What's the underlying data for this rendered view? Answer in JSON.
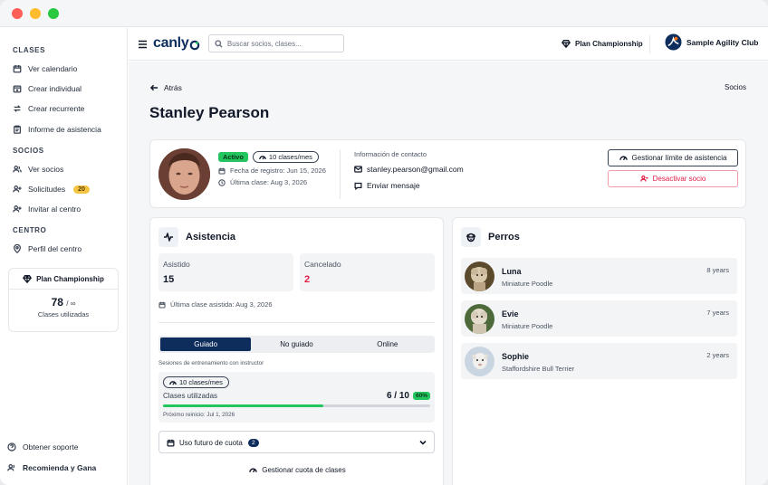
{
  "sidebar": {
    "sections": {
      "clases": "CLASES",
      "socios": "SOCIOS",
      "centro": "CENTRO"
    },
    "items": {
      "calendar": "Ver calendario",
      "individual": "Crear individual",
      "recurrent": "Crear recurrente",
      "attendance_report": "Informe de asistencia",
      "members": "Ver socios",
      "requests": "Solicitudes",
      "requests_badge": "20",
      "invite": "Invitar al centro",
      "profile": "Perfil del centro"
    },
    "plan": {
      "name": "Plan Championship",
      "count": "78",
      "limit": "/ ∞",
      "label": "Clases utilizadas"
    },
    "bottom": {
      "support": "Obtener soporte",
      "refer": "Recomienda y Gana"
    }
  },
  "topbar": {
    "logo": "canly",
    "search_placeholder": "Buscar socios, clases...",
    "plan": "Plan Championship",
    "club": "Sample Agility Club"
  },
  "page": {
    "back": "Atrás",
    "breadcrumb_right": "Socios",
    "title": "Stanley Pearson"
  },
  "profile": {
    "status": "Activo",
    "quota": "10 clases/mes",
    "registered": "Fecha de registro: Jun 15, 2026",
    "last_class": "Última clase: Aug 3, 2026",
    "contact_title": "Información de contacto",
    "email": "stanley.pearson@gmail.com",
    "message": "Enviar mensaje",
    "manage_limit": "Gestionar límite de asistencia",
    "deactivate": "Desactivar socio"
  },
  "attendance": {
    "title": "Asistencia",
    "attended_label": "Asistido",
    "attended_value": "15",
    "cancelled_label": "Cancelado",
    "cancelled_value": "2",
    "last_attended": "Última clase asistida: Aug 3, 2026",
    "tabs": [
      "Guiado",
      "No guiado",
      "Online"
    ],
    "tab_desc": "Sesiones de entrenamiento con instructor",
    "quota": "10 clases/mes",
    "used_label": "Clases utilizadas",
    "used_value": "6 / 10",
    "used_pct": "60%",
    "progress": 0.6,
    "reset": "Próximo reinicio: Jul 1, 2026",
    "future_label": "Uso futuro de cuota",
    "future_count": "2",
    "manage_quota": "Gestionar cuota de clases"
  },
  "dogs": {
    "title": "Perros",
    "items": [
      {
        "name": "Luna",
        "breed": "Miniature Poodle",
        "age": "8 years"
      },
      {
        "name": "Evie",
        "breed": "Miniature Poodle",
        "age": "7 years"
      },
      {
        "name": "Sophie",
        "breed": "Staffordshire Bull Terrier",
        "age": "2 years"
      }
    ]
  },
  "colors": {
    "accent": "#0f2d5c",
    "green": "#22c55e",
    "danger": "#e11d48"
  }
}
